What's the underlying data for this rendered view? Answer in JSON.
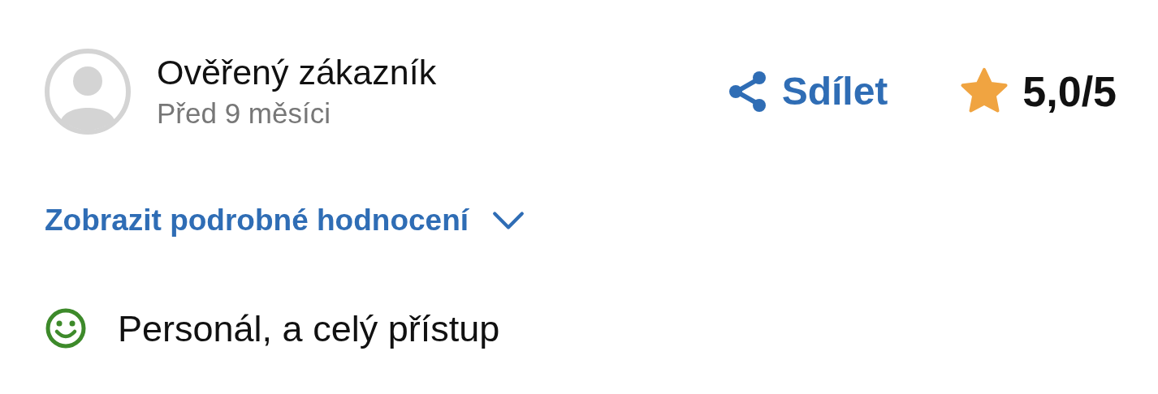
{
  "review": {
    "author": "Ověřený zákazník",
    "time": "Před 9 měsíci",
    "share": {
      "label": "Sdílet"
    },
    "rating": "5,0/5",
    "details_toggle": {
      "label": "Zobrazit podrobné hodnocení",
      "expanded": false
    },
    "positives": [
      {
        "text": "Personál, a celý přístup"
      }
    ]
  }
}
